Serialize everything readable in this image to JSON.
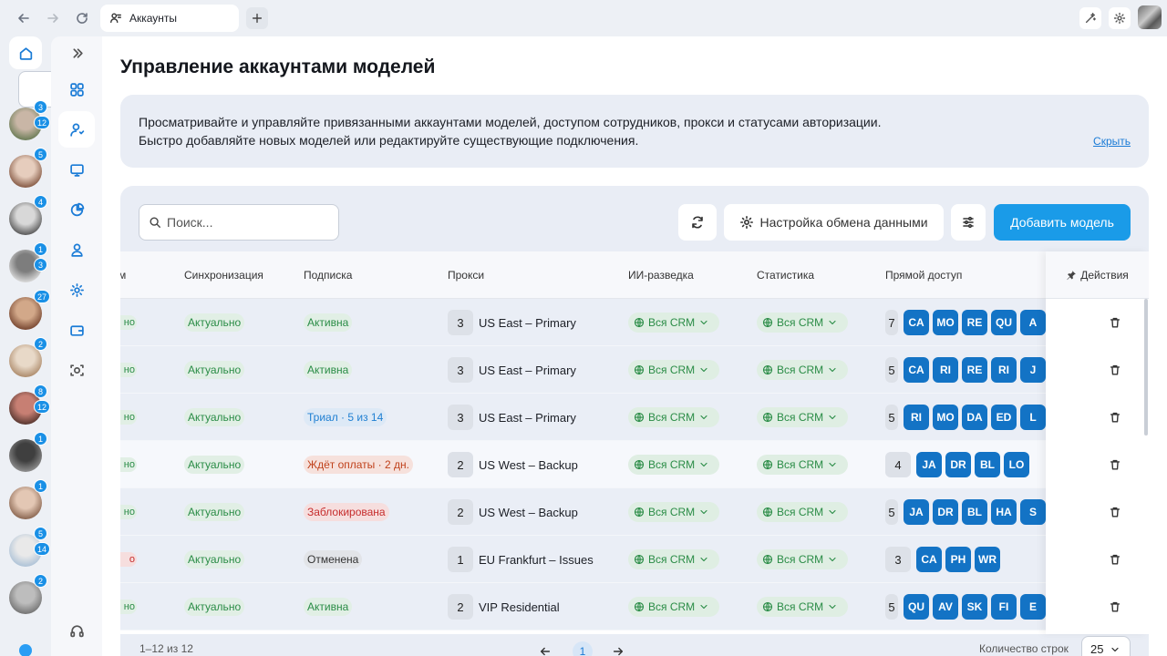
{
  "browser": {
    "tab_title": "Аккаунты",
    "new_tab": "+"
  },
  "rail": {
    "avatars": [
      {
        "badges": [
          "3",
          "12"
        ],
        "colors": [
          "#c9b6a6",
          "#6f7f5a"
        ]
      },
      {
        "badges": [
          "5"
        ],
        "colors": [
          "#e6cdbd",
          "#8a5f4a"
        ]
      },
      {
        "badges": [
          "4"
        ],
        "colors": [
          "#d8d8d8",
          "#5e5e5e"
        ]
      },
      {
        "badges": [
          "1",
          "3"
        ],
        "colors": [
          "#7d7d7d",
          "#d6d6d6"
        ]
      },
      {
        "badges": [
          "27"
        ],
        "colors": [
          "#d2a889",
          "#7b4b35"
        ]
      },
      {
        "badges": [
          "2"
        ],
        "colors": [
          "#e8d9c8",
          "#b08f70"
        ]
      },
      {
        "badges": [
          "8",
          "12"
        ],
        "colors": [
          "#c77f73",
          "#5c3a33"
        ]
      },
      {
        "badges": [
          "1"
        ],
        "colors": [
          "#3f3f3f",
          "#8c8c8c"
        ]
      },
      {
        "badges": [
          "1"
        ],
        "colors": [
          "#e3c7b4",
          "#8e6a55"
        ]
      },
      {
        "badges": [
          "5",
          "14"
        ],
        "colors": [
          "#e9e9e9",
          "#b0c4d8"
        ]
      },
      {
        "badges": [
          "2"
        ],
        "colors": [
          "#bdbdbd",
          "#777"
        ]
      }
    ]
  },
  "page": {
    "title": "Управление аккаунтами моделей",
    "info_line1": "Просматривайте и управляйте привязанными аккаунтами моделей, доступом сотрудников, прокси и статусами авторизации.",
    "info_line2": "Быстро добавляйте новых моделей или редактируйте существующие подключения.",
    "hide_label": "Скрыть"
  },
  "toolbar": {
    "search_placeholder": "Поиск...",
    "exchange_label": "Настройка обмена данными",
    "add_label": "Добавить модель"
  },
  "table": {
    "columns": {
      "cut": "м",
      "sync": "Синхронизация",
      "subscription": "Подписка",
      "proxy": "Прокси",
      "ai": "ИИ-разведка",
      "stats": "Статистика",
      "direct": "Прямой доступ",
      "actions": "Действия"
    },
    "rows": [
      {
        "stub": "но",
        "stub_color": "green",
        "sync": "Актуально",
        "sub": "Активна",
        "sub_color": "green",
        "proxy_n": "3",
        "proxy": "US East – Primary",
        "ai": "Вся CRM",
        "stats": "Вся CRM",
        "count": "7",
        "accounts": [
          "CA",
          "MO",
          "RE",
          "QU",
          "A"
        ]
      },
      {
        "stub": "но",
        "stub_color": "green",
        "sync": "Актуально",
        "sub": "Активна",
        "sub_color": "green",
        "proxy_n": "3",
        "proxy": "US East – Primary",
        "ai": "Вся CRM",
        "stats": "Вся CRM",
        "count": "5",
        "accounts": [
          "CA",
          "RI",
          "RE",
          "RI",
          "J"
        ]
      },
      {
        "stub": "но",
        "stub_color": "green",
        "sync": "Актуально",
        "sub": "Триал · 5 из 14",
        "sub_color": "blue",
        "proxy_n": "3",
        "proxy": "US East – Primary",
        "ai": "Вся CRM",
        "stats": "Вся CRM",
        "count": "5",
        "accounts": [
          "RI",
          "MO",
          "DA",
          "ED",
          "L"
        ]
      },
      {
        "stub": "но",
        "stub_color": "green",
        "sync": "Актуально",
        "sub": "Ждёт оплаты · 2 дн.",
        "sub_color": "orange",
        "proxy_n": "2",
        "proxy": "US West – Backup",
        "ai": "Вся CRM",
        "stats": "Вся CRM",
        "count": "4",
        "accounts": [
          "JA",
          "DR",
          "BL",
          "LO"
        ]
      },
      {
        "stub": "но",
        "stub_color": "green",
        "sync": "Актуально",
        "sub": "Заблокирована",
        "sub_color": "red",
        "proxy_n": "2",
        "proxy": "US West – Backup",
        "ai": "Вся CRM",
        "stats": "Вся CRM",
        "count": "5",
        "accounts": [
          "JA",
          "DR",
          "BL",
          "HA",
          "S"
        ]
      },
      {
        "stub": "о",
        "stub_color": "red",
        "sync": "Актуально",
        "sub": "Отменена",
        "sub_color": "grey",
        "proxy_n": "1",
        "proxy": "EU Frankfurt – Issues",
        "ai": "Вся CRM",
        "stats": "Вся CRM",
        "count": "3",
        "accounts": [
          "CA",
          "PH",
          "WR"
        ]
      },
      {
        "stub": "но",
        "stub_color": "green",
        "sync": "Актуально",
        "sub": "Активна",
        "sub_color": "green",
        "proxy_n": "2",
        "proxy": "VIP Residential",
        "ai": "Вся CRM",
        "stats": "Вся CRM",
        "count": "5",
        "accounts": [
          "QU",
          "AV",
          "SK",
          "FI",
          "E"
        ]
      }
    ],
    "highlighted_row": 3
  },
  "footer": {
    "range": "1–12 из 12",
    "page": "1",
    "rows_label": "Количество строк",
    "rows_value": "25"
  }
}
